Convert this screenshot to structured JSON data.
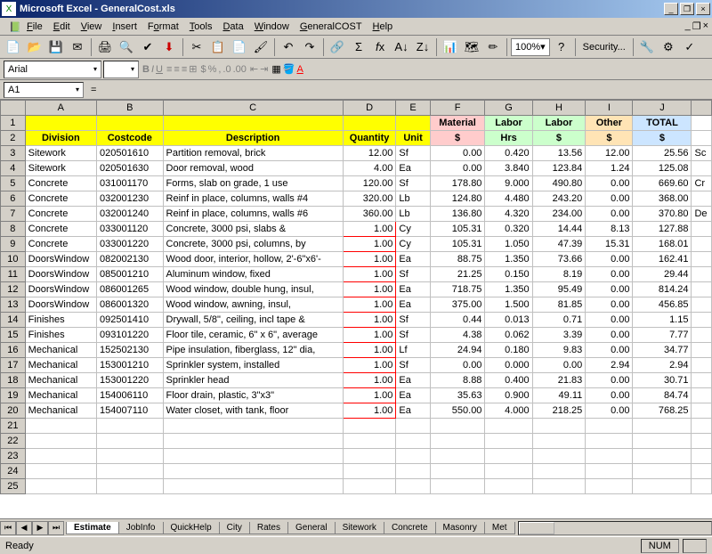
{
  "title": "Microsoft Excel - GeneralCost.xls",
  "menus": [
    "File",
    "Edit",
    "View",
    "Insert",
    "Format",
    "Tools",
    "Data",
    "Window",
    "GeneralCOST",
    "Help"
  ],
  "font": "Arial",
  "fontSize": "",
  "zoom": "100%",
  "security": "Security...",
  "nameBox": "A1",
  "columns": [
    "A",
    "B",
    "C",
    "D",
    "E",
    "F",
    "G",
    "H",
    "I",
    "J",
    ""
  ],
  "headers1": [
    "",
    "",
    "",
    "",
    "",
    "Material",
    "Labor",
    "Labor",
    "Other",
    "TOTAL",
    ""
  ],
  "headers2": [
    "Division",
    "Costcode",
    "Description",
    "Quantity",
    "Unit",
    "$",
    "Hrs",
    "$",
    "$",
    "$",
    ""
  ],
  "rows": [
    {
      "n": 3,
      "d": [
        "Sitework",
        "020501610",
        "Partition removal, brick",
        "12.00",
        "Sf",
        "0.00",
        "0.420",
        "13.56",
        "12.00",
        "25.56",
        "Sc"
      ]
    },
    {
      "n": 4,
      "d": [
        "Sitework",
        "020501630",
        "Door removal, wood",
        "4.00",
        "Ea",
        "0.00",
        "3.840",
        "123.84",
        "1.24",
        "125.08",
        ""
      ]
    },
    {
      "n": 5,
      "d": [
        "Concrete",
        "031001170",
        "Forms, slab on grade, 1 use",
        "120.00",
        "Sf",
        "178.80",
        "9.000",
        "490.80",
        "0.00",
        "669.60",
        "Cr"
      ]
    },
    {
      "n": 6,
      "d": [
        "Concrete",
        "032001230",
        "Reinf in place, columns, walls #4",
        "320.00",
        "Lb",
        "124.80",
        "4.480",
        "243.20",
        "0.00",
        "368.00",
        ""
      ]
    },
    {
      "n": 7,
      "d": [
        "Concrete",
        "032001240",
        "Reinf in place, columns, walls #6",
        "360.00",
        "Lb",
        "136.80",
        "4.320",
        "234.00",
        "0.00",
        "370.80",
        "De"
      ]
    },
    {
      "n": 8,
      "d": [
        "Concrete",
        "033001120",
        "Concrete, 3000 psi, slabs &",
        "1.00",
        "Cy",
        "105.31",
        "0.320",
        "14.44",
        "8.13",
        "127.88",
        ""
      ],
      "red": true
    },
    {
      "n": 9,
      "d": [
        "Concrete",
        "033001220",
        "Concrete, 3000 psi, columns, by",
        "1.00",
        "Cy",
        "105.31",
        "1.050",
        "47.39",
        "15.31",
        "168.01",
        ""
      ],
      "red": true
    },
    {
      "n": 10,
      "d": [
        "DoorsWindow",
        "082002130",
        "Wood door, interior, hollow, 2'-6\"x6'-",
        "1.00",
        "Ea",
        "88.75",
        "1.350",
        "73.66",
        "0.00",
        "162.41",
        ""
      ],
      "red": true
    },
    {
      "n": 11,
      "d": [
        "DoorsWindow",
        "085001210",
        "Aluminum window, fixed",
        "1.00",
        "Sf",
        "21.25",
        "0.150",
        "8.19",
        "0.00",
        "29.44",
        ""
      ],
      "red": true
    },
    {
      "n": 12,
      "d": [
        "DoorsWindow",
        "086001265",
        "Wood window, double hung, insul,",
        "1.00",
        "Ea",
        "718.75",
        "1.350",
        "95.49",
        "0.00",
        "814.24",
        ""
      ],
      "red": true
    },
    {
      "n": 13,
      "d": [
        "DoorsWindow",
        "086001320",
        "Wood window, awning, insul,",
        "1.00",
        "Ea",
        "375.00",
        "1.500",
        "81.85",
        "0.00",
        "456.85",
        ""
      ],
      "red": true
    },
    {
      "n": 14,
      "d": [
        "Finishes",
        "092501410",
        "Drywall, 5/8\", ceiling, incl tape &",
        "1.00",
        "Sf",
        "0.44",
        "0.013",
        "0.71",
        "0.00",
        "1.15",
        ""
      ],
      "red": true
    },
    {
      "n": 15,
      "d": [
        "Finishes",
        "093101220",
        "Floor tile, ceramic, 6\" x 6\", average",
        "1.00",
        "Sf",
        "4.38",
        "0.062",
        "3.39",
        "0.00",
        "7.77",
        ""
      ],
      "red": true
    },
    {
      "n": 16,
      "d": [
        "Mechanical",
        "152502130",
        "Pipe insulation, fiberglass, 12\" dia,",
        "1.00",
        "Lf",
        "24.94",
        "0.180",
        "9.83",
        "0.00",
        "34.77",
        ""
      ],
      "red": true
    },
    {
      "n": 17,
      "d": [
        "Mechanical",
        "153001210",
        "Sprinkler system, installed",
        "1.00",
        "Sf",
        "0.00",
        "0.000",
        "0.00",
        "2.94",
        "2.94",
        ""
      ],
      "red": true
    },
    {
      "n": 18,
      "d": [
        "Mechanical",
        "153001220",
        "Sprinkler head",
        "1.00",
        "Ea",
        "8.88",
        "0.400",
        "21.83",
        "0.00",
        "30.71",
        ""
      ],
      "red": true
    },
    {
      "n": 19,
      "d": [
        "Mechanical",
        "154006110",
        "Floor drain, plastic, 3\"x3\"",
        "1.00",
        "Ea",
        "35.63",
        "0.900",
        "49.11",
        "0.00",
        "84.74",
        ""
      ],
      "red": true
    },
    {
      "n": 20,
      "d": [
        "Mechanical",
        "154007110",
        "Water closet, with tank, floor",
        "1.00",
        "Ea",
        "550.00",
        "4.000",
        "218.25",
        "0.00",
        "768.25",
        ""
      ],
      "red": true
    }
  ],
  "emptyRows": [
    21,
    22,
    23,
    24,
    25
  ],
  "tabs": [
    "Estimate",
    "JobInfo",
    "QuickHelp",
    "City",
    "Rates",
    "General",
    "Sitework",
    "Concrete",
    "Masonry",
    "Met"
  ],
  "activeTab": 0,
  "status": "Ready",
  "statusNum": "NUM"
}
